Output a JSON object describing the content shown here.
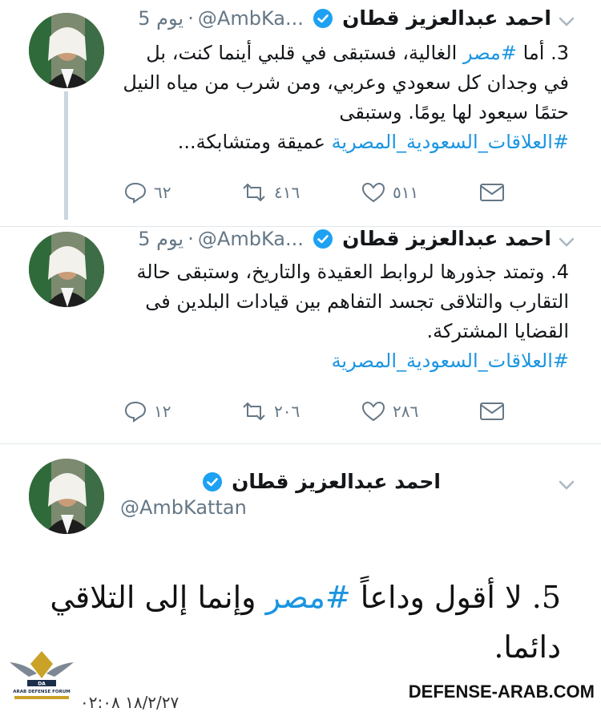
{
  "tweets": [
    {
      "name": "احمد عبدالعزيز قطان",
      "handle": "@AmbKa...",
      "time": "5 يوم",
      "body_pre": "3.  أما ",
      "body_hash1": "#مصر",
      "body_mid": " الغالية، فستبقى في قلبي أينما كنت، بل في وجدان كل سعودي وعربي، ومن شرب من مياه النيل حتمًا سيعود لها يومًا. وستبقى ",
      "body_hash2": "#العلاقات_السعودية_المصرية",
      "body_post": " عميقة ومتشابكة...",
      "replies": "٦٢",
      "retweets": "٤١٦",
      "likes": "٥١١"
    },
    {
      "name": "احمد عبدالعزيز قطان",
      "handle": "@AmbKa...",
      "time": "5 يوم",
      "body_text": "4. وتمتد جذورها لروابط العقيدة والتاريخ، وستبقى حالة التقارب والتلاقى تجسد التفاهم بين  قيادات البلدين فى القضايا المشتركة.",
      "body_hash": "#العلاقات_السعودية_المصرية",
      "replies": "١٢",
      "retweets": "٢٠٦",
      "likes": "٢٨٦"
    },
    {
      "name": "احمد عبدالعزيز قطان",
      "handle": "@AmbKattan",
      "big_pre": "5.   لا أقول وداعاً ",
      "big_hash": "#مصر",
      "big_post": " وإنما إلى التلاقي دائما."
    }
  ],
  "watermark": {
    "site": "DEFENSE-ARAB.COM",
    "forum": "ARAB DEFENSE FORUM",
    "date": "١٨/٢/٢٧ ٠٢:٠٨"
  },
  "colors": {
    "link": "#1b95e0",
    "verified": "#1da1f2",
    "muted": "#657786"
  },
  "icons": [
    "reply-icon",
    "retweet-icon",
    "like-icon",
    "dm-icon",
    "verified-icon",
    "chevron-down-icon"
  ]
}
